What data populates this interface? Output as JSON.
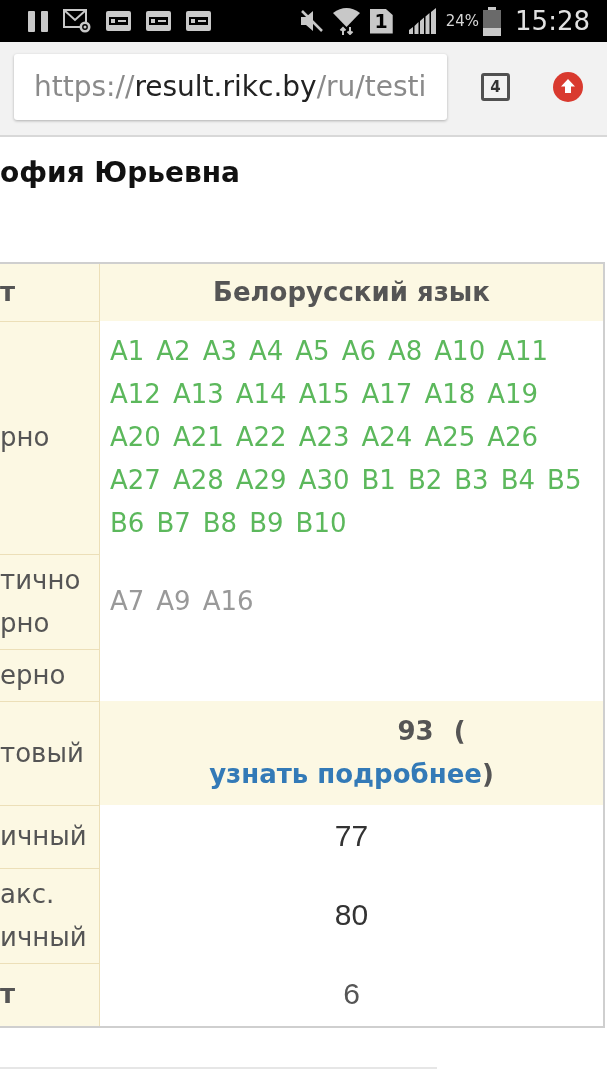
{
  "status_bar": {
    "sim": "1",
    "battery": "24%",
    "time": "15:28"
  },
  "browser": {
    "address": {
      "scheme": "https://",
      "host": "result.rikc.by",
      "path": "/ru/testi"
    },
    "tab_count": "4"
  },
  "page": {
    "title": "офия Юрьевна"
  },
  "table": {
    "header": {
      "label": "т",
      "subject": "Белорусский язык"
    },
    "rows": [
      {
        "kind": "answers",
        "label": "рно",
        "color": "#5cb85c",
        "answers": [
          "A1",
          "A2",
          "A3",
          "A4",
          "A5",
          "A6",
          "A8",
          "A10",
          "A11",
          "A12",
          "A13",
          "A14",
          "A15",
          "A17",
          "A18",
          "A19",
          "A20",
          "A21",
          "A22",
          "A23",
          "A24",
          "A25",
          "A26",
          "A27",
          "A28",
          "A29",
          "A30",
          "B1",
          "B2",
          "B3",
          "B4",
          "B5",
          "B6",
          "B7",
          "B8",
          "B9",
          "B10"
        ]
      },
      {
        "kind": "answers",
        "label": "тично рно",
        "color": "#999999",
        "answers": [
          "A7",
          "A9",
          "A16"
        ]
      },
      {
        "kind": "answers",
        "label": "ерно"
      },
      {
        "kind": "total",
        "label": "товый",
        "score": "93",
        "link_open": "(",
        "link": "узнать подробнее",
        "link_close": ")"
      },
      {
        "kind": "number",
        "label": "ичный",
        "value": "77"
      },
      {
        "kind": "number",
        "label": "акс. ичный",
        "value": "80"
      },
      {
        "kind": "place",
        "label": "т",
        "value": "6"
      }
    ]
  }
}
